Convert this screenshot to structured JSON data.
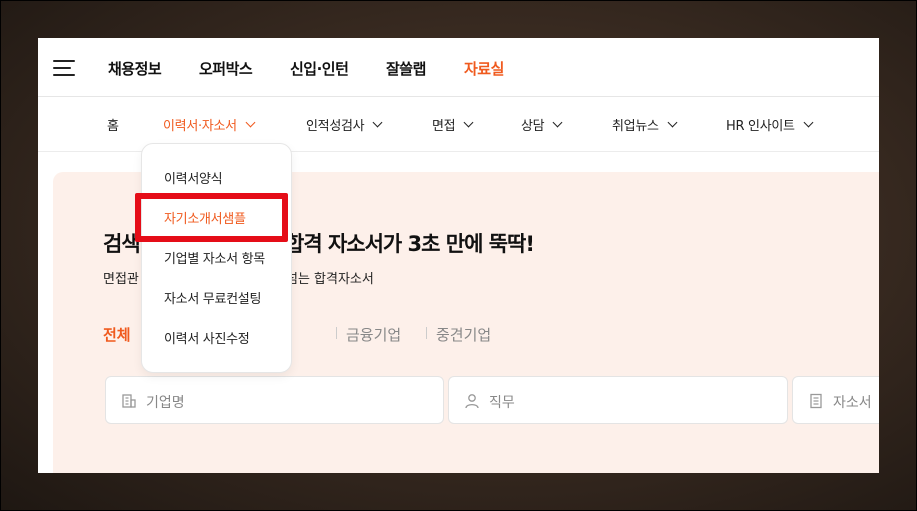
{
  "top_nav": {
    "items": [
      {
        "label": "채용정보",
        "active": false
      },
      {
        "label": "오퍼박스",
        "active": false
      },
      {
        "label": "신입·인턴",
        "active": false
      },
      {
        "label": "잘쓸랩",
        "active": false
      },
      {
        "label": "자료실",
        "active": true
      }
    ]
  },
  "sub_nav": {
    "items": [
      {
        "label": "홈",
        "has_dropdown": false
      },
      {
        "label": "이력서·자소서",
        "has_dropdown": true,
        "active": true
      },
      {
        "label": "인적성검사",
        "has_dropdown": true
      },
      {
        "label": "면접",
        "has_dropdown": true
      },
      {
        "label": "상담",
        "has_dropdown": true
      },
      {
        "label": "취업뉴스",
        "has_dropdown": true
      },
      {
        "label": "HR 인사이트",
        "has_dropdown": true
      }
    ]
  },
  "dropdown": {
    "items": [
      {
        "label": "이력서양식",
        "active": false
      },
      {
        "label": "자기소개서샘플",
        "active": true
      },
      {
        "label": "기업별 자소서 항목",
        "active": false
      },
      {
        "label": "자소서 무료컨설팅",
        "active": false
      },
      {
        "label": "이력서 사진수정",
        "active": false
      }
    ]
  },
  "main": {
    "headline_start": "검색",
    "headline_end": "합격 자소서가 3초 만에 뚝딱!",
    "subline_start": "면접관",
    "subline_end": "넘는 합격자소서",
    "categories": [
      "전체",
      "금융기업",
      "중견기업"
    ],
    "search": {
      "company_placeholder": "기업명",
      "job_placeholder": "직무",
      "essay_placeholder": "자소서"
    }
  },
  "colors": {
    "accent": "#f05a1e",
    "highlight_border": "#e50d18",
    "content_bg": "#fdf0ea"
  }
}
